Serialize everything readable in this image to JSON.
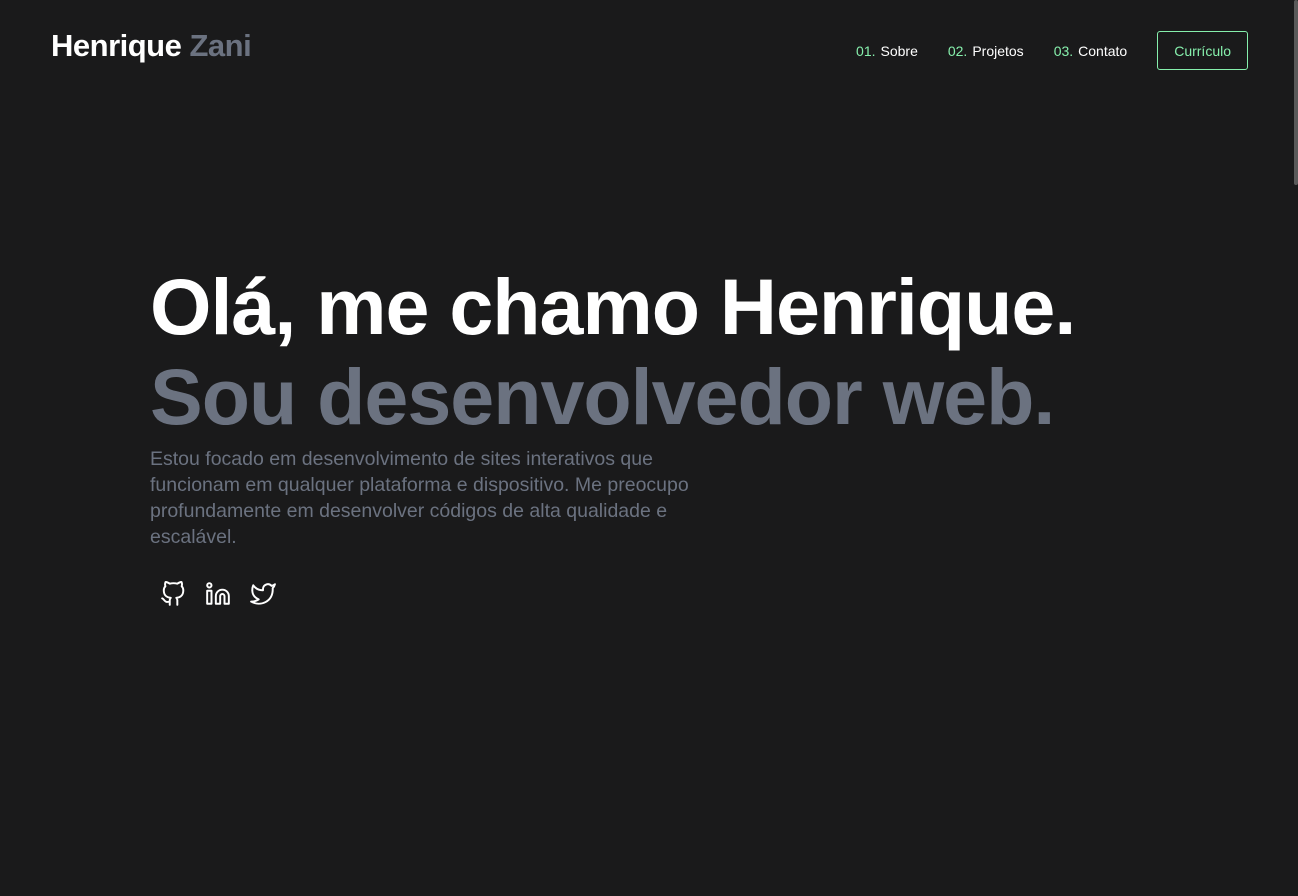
{
  "header": {
    "logo_first": "Henrique",
    "logo_last": "Zani",
    "nav": [
      {
        "num": "01.",
        "label": "Sobre"
      },
      {
        "num": "02.",
        "label": "Projetos"
      },
      {
        "num": "03.",
        "label": "Contato"
      }
    ],
    "cv_label": "Currículo"
  },
  "hero": {
    "headline": "Olá, me chamo Henrique.",
    "subline": "Sou desenvolvedor web.",
    "bio": "Estou focado em desenvolvimento de sites interativos que funcionam em qualquer plataforma e dispositivo. Me preocupo profundamente em desenvolver códigos de alta qualidade e escalável."
  },
  "socials": [
    {
      "icon": "github-icon"
    },
    {
      "icon": "linkedin-icon"
    },
    {
      "icon": "twitter-icon"
    }
  ],
  "colors": {
    "background": "#1a1a1b",
    "text": "#ffffff",
    "muted": "#6b7280",
    "accent": "#86efac"
  }
}
